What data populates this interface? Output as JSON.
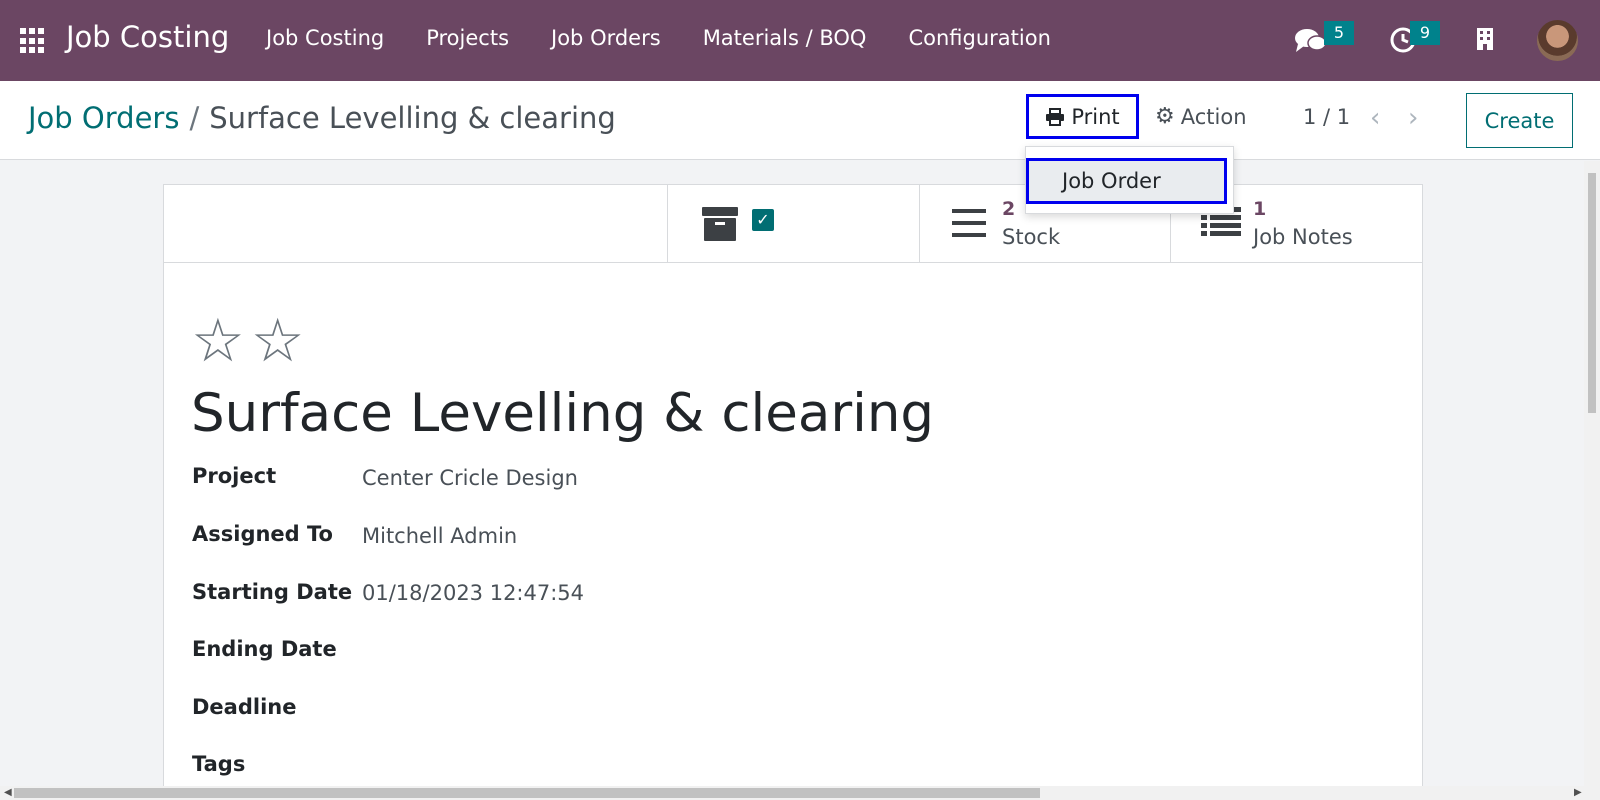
{
  "navbar": {
    "brand": "Job Costing",
    "menu": [
      "Job Costing",
      "Projects",
      "Job Orders",
      "Materials / BOQ",
      "Configuration"
    ],
    "messages_count": "5",
    "activities_count": "9",
    "icons": [
      "apps-grid-icon",
      "chat-icon",
      "clock-icon",
      "building-icon",
      "avatar"
    ],
    "color": "#6b4663"
  },
  "control": {
    "breadcrumb_parent": "Job Orders",
    "breadcrumb_sep": "/",
    "breadcrumb_current": "Surface Levelling & clearing",
    "print_label": "Print",
    "action_label": "Action",
    "pager": "1 / 1",
    "create_label": "Create"
  },
  "print_dropdown": {
    "items": [
      "Job Order"
    ]
  },
  "smart_buttons": [
    {
      "count": "2",
      "label": "Stock",
      "icon": "list-icon"
    },
    {
      "count": "1",
      "label": "Job Notes",
      "icon": "list-bullets-icon"
    }
  ],
  "form": {
    "title": "Surface Levelling & clearing",
    "fields": [
      {
        "label": "Project",
        "value": "Center Cricle Design"
      },
      {
        "label": "Assigned To",
        "value": "Mitchell Admin"
      },
      {
        "label": "Starting Date",
        "value": "01/18/2023 12:47:54"
      },
      {
        "label": "Ending Date",
        "value": ""
      },
      {
        "label": "Deadline",
        "value": ""
      },
      {
        "label": "Tags",
        "value": ""
      }
    ]
  },
  "colors": {
    "accent": "#016e73",
    "highlight_border": "#0000ee"
  }
}
